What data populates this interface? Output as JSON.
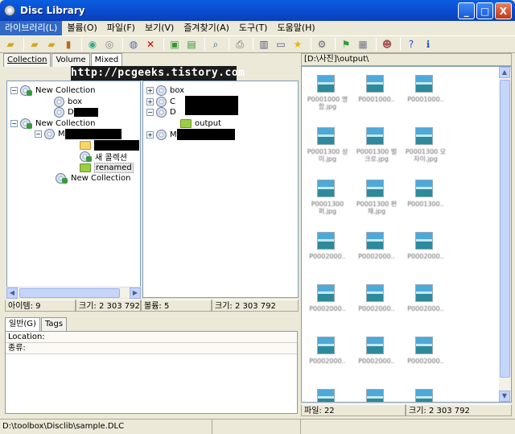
{
  "window": {
    "title": "Disc Library",
    "min": "_",
    "max": "□",
    "close": "X"
  },
  "menu": [
    "라이브러리(L)",
    "볼륨(O)",
    "파일(F)",
    "보기(V)",
    "즐겨찾기(A)",
    "도구(T)",
    "도움말(H)"
  ],
  "left_tabs": [
    "Collection",
    "Volume",
    "Mixed"
  ],
  "watermark": "http://pcgeeks.tistory.com",
  "tree1": {
    "collection1": "New Collection",
    "box": "box",
    "d_label": "D",
    "collection2": "New Collection",
    "m_label": "M",
    "new_collection_ko": "새 콜렉션",
    "renamed": "renamed",
    "collection3": "New Collection"
  },
  "tree2": {
    "box": "box",
    "c_label": "C",
    "d_label": "D",
    "output": "output",
    "m_label": "M"
  },
  "left_status": {
    "items": "아이템: 9",
    "size1": "크기: 2 303 792",
    "volumes": "볼륨: 5",
    "size2": "크기: 2 303 792"
  },
  "bottom_tabs": [
    "일반(G)",
    "Tags"
  ],
  "props": {
    "location": "Location:",
    "type": "종류:"
  },
  "path": "[D:\\사진]\\output\\",
  "thumbnails": [
    "P0001000 명함.jpg",
    "P0001000..",
    "P0001000..",
    "P0001300 성미.jpg",
    "P0001300 벌크로.jpg",
    "P0001300 모자이.jpg",
    "P0001300 퍼.jpg",
    "P0001300 편채.jpg",
    "P0001300..",
    "P0002000..",
    "P0002000..",
    "P0002000..",
    "P0002000..",
    "P0002000..",
    "P0002000..",
    "P0002000..",
    "P0002000..",
    "P0002000..",
    "",
    "",
    ""
  ],
  "right_status": {
    "files": "파일: 22",
    "size": "크기: 2 303 792"
  },
  "main_status": "D:\\toolbox\\Disclib\\sample.DLC",
  "colors": {
    "titlebar": "#0b4dd1",
    "menu_active": "#316ac5"
  }
}
